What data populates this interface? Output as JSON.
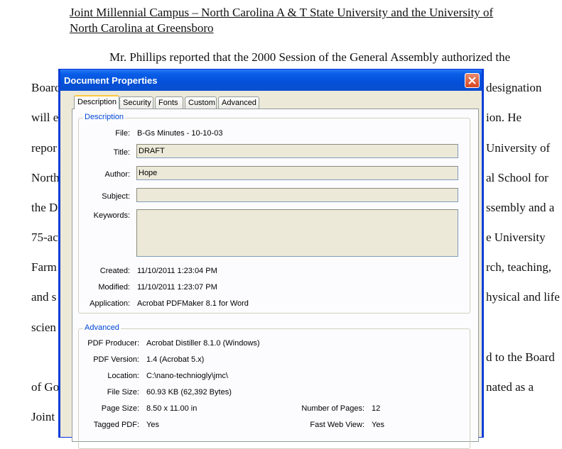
{
  "document": {
    "heading_line1": "Joint Millennial Campus – North Carolina A & T State University and the University of",
    "heading_line2": "North Carolina at Greensboro",
    "para1": "Mr. Phillips reported that the 2000 Session of the General Assembly authorized the",
    "left_fragments": [
      "Board",
      "will e",
      "repor",
      "North",
      "the D",
      "75-ac",
      "Farm",
      "and s",
      "scien",
      "of Go",
      "Joint"
    ],
    "right_fragments": [
      "designation",
      "ion.  He",
      "University of",
      "al School for",
      "ssembly and a",
      "e University",
      "rch, teaching,",
      "hysical and life",
      "d to the Board",
      "nated as a"
    ]
  },
  "dialog": {
    "title": "Document Properties",
    "tabs": [
      "Description",
      "Security",
      "Fonts",
      "Custom",
      "Advanced"
    ],
    "active_tab": "Description",
    "description_group": {
      "label": "Description",
      "file_label": "File:",
      "file_value": "B-Gs Minutes - 10-10-03",
      "title_label": "Title:",
      "title_value": "DRAFT",
      "author_label": "Author:",
      "author_value": "Hope",
      "subject_label": "Subject:",
      "subject_value": "",
      "keywords_label": "Keywords:",
      "keywords_value": "",
      "created_label": "Created:",
      "created_value": "11/10/2011 1:23:04 PM",
      "modified_label": "Modified:",
      "modified_value": "11/10/2011 1:23:07 PM",
      "application_label": "Application:",
      "application_value": "Acrobat PDFMaker 8.1 for Word"
    },
    "advanced_group": {
      "label": "Advanced",
      "producer_label": "PDF Producer:",
      "producer_value": "Acrobat Distiller 8.1.0 (Windows)",
      "version_label": "PDF Version:",
      "version_value": "1.4 (Acrobat 5.x)",
      "location_label": "Location:",
      "location_value": "C:\\nano-technioglу\\jmc\\",
      "filesize_label": "File Size:",
      "filesize_value": "60.93 KB (62,392 Bytes)",
      "pagesize_label": "Page Size:",
      "pagesize_value": "8.50 x 11.00 in",
      "pages_label": "Number of Pages:",
      "pages_value": "12",
      "tagged_label": "Tagged PDF:",
      "tagged_value": "Yes",
      "fastweb_label": "Fast Web View:",
      "fastweb_value": "Yes"
    }
  }
}
